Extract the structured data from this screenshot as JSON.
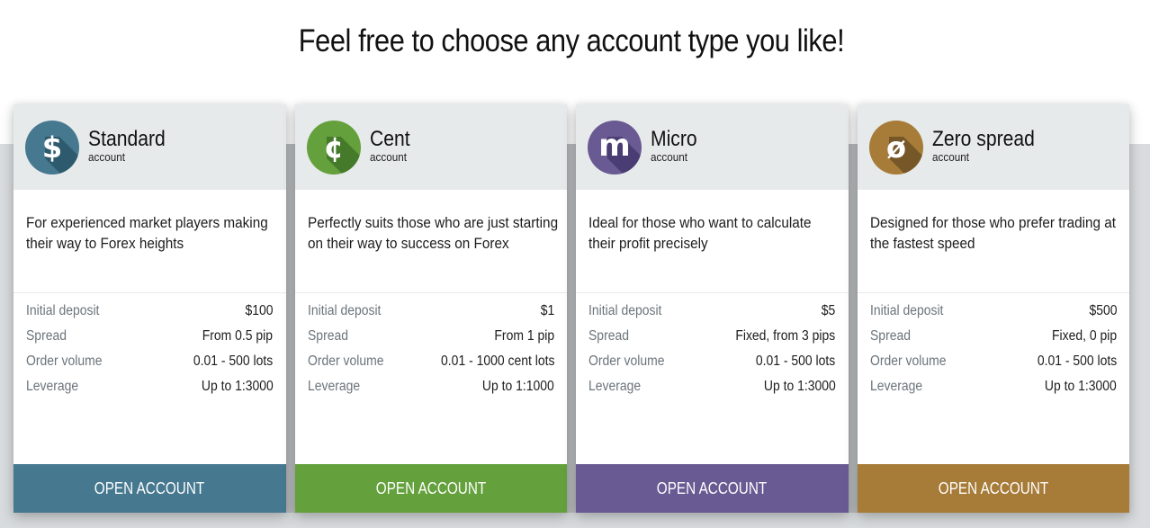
{
  "page": {
    "heading": "Feel free to choose any account type you like!"
  },
  "accounts": [
    {
      "name": "Standard",
      "subtitle": "account",
      "icon": "dollar-icon",
      "glyph": "$",
      "color": "#46788f",
      "shade": "#2e5a6e",
      "description": "For experienced market players making their way to Forex heights",
      "specs": [
        {
          "label": "Initial deposit",
          "value": "$100"
        },
        {
          "label": "Spread",
          "value": "From 0.5 pip"
        },
        {
          "label": "Order volume",
          "value": "0.01 - 500 lots"
        },
        {
          "label": "Leverage",
          "value": "Up to 1:3000"
        }
      ],
      "button": "OPEN ACCOUNT"
    },
    {
      "name": "Cent",
      "subtitle": "account",
      "icon": "cent-icon",
      "glyph": "¢",
      "color": "#64a03c",
      "shade": "#467a2b",
      "description": "Perfectly suits those who are just starting on their way to success on Forex",
      "specs": [
        {
          "label": "Initial deposit",
          "value": "$1"
        },
        {
          "label": "Spread",
          "value": "From 1 pip"
        },
        {
          "label": "Order volume",
          "value": "0.01 - 1000 cent lots"
        },
        {
          "label": "Leverage",
          "value": "Up to 1:1000"
        }
      ],
      "button": "OPEN ACCOUNT"
    },
    {
      "name": "Micro",
      "subtitle": "account",
      "icon": "micro-m-icon",
      "glyph": "m",
      "color": "#6a5a93",
      "shade": "#4a3d73",
      "description": "Ideal for those who want to calculate their profit precisely",
      "specs": [
        {
          "label": "Initial deposit",
          "value": "$5"
        },
        {
          "label": "Spread",
          "value": "Fixed, from 3 pips"
        },
        {
          "label": "Order volume",
          "value": "0.01 - 500 lots"
        },
        {
          "label": "Leverage",
          "value": "Up to 1:3000"
        }
      ],
      "button": "OPEN ACCOUNT"
    },
    {
      "name": "Zero spread",
      "subtitle": "account",
      "icon": "zero-slash-icon",
      "glyph": "ø",
      "color": "#a77b38",
      "shade": "#765728",
      "description": "Designed for those who prefer trading at the fastest speed",
      "specs": [
        {
          "label": "Initial deposit",
          "value": "$500"
        },
        {
          "label": "Spread",
          "value": "Fixed, 0 pip"
        },
        {
          "label": "Order volume",
          "value": "0.01 - 500 lots"
        },
        {
          "label": "Leverage",
          "value": "Up to 1:3000"
        }
      ],
      "button": "OPEN ACCOUNT"
    }
  ]
}
